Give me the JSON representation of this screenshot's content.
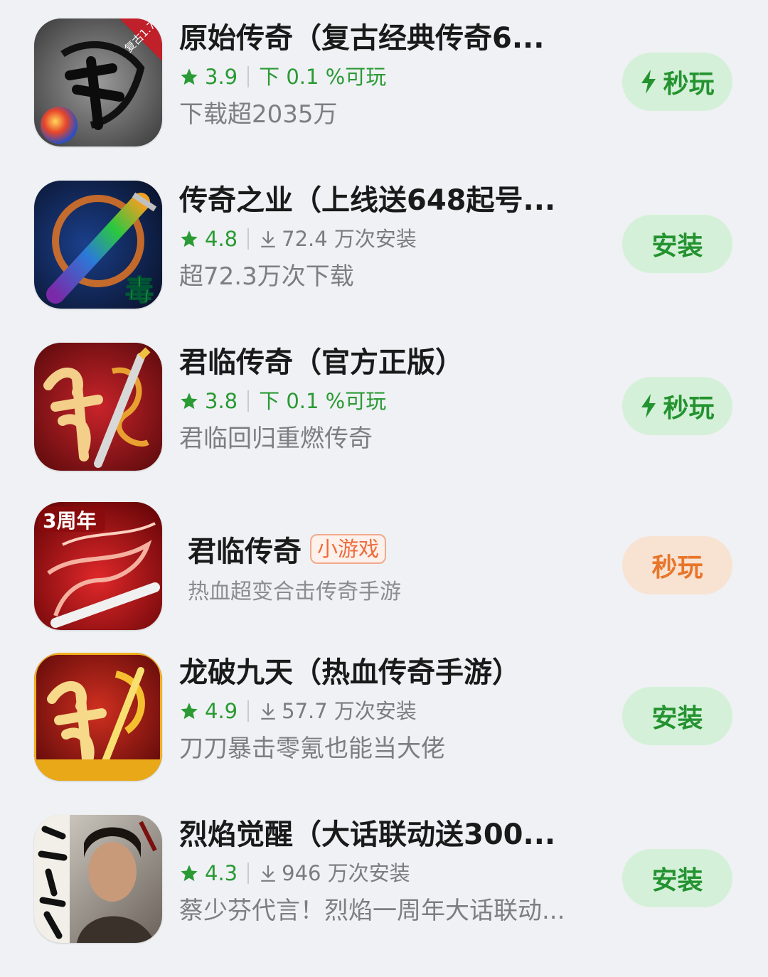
{
  "apps": [
    {
      "title": "原始传奇（复古经典传奇6...",
      "rating": "3.9",
      "meta_text": "下 0.1 %可玩",
      "desc": "下载超2035万",
      "button": "秒玩",
      "button_type": "quick"
    },
    {
      "title": "传奇之业（上线送648起号...",
      "rating": "4.8",
      "meta_text": "72.4 万次安装",
      "desc": "超72.3万次下载",
      "button": "安装",
      "button_type": "install"
    },
    {
      "title": "君临传奇（官方正版）",
      "rating": "3.8",
      "meta_text": "下 0.1 %可玩",
      "desc": "君临回归重燃传奇",
      "button": "秒玩",
      "button_type": "quick"
    },
    {
      "title": "君临传奇",
      "tag": "小游戏",
      "desc": "热血超变合击传奇手游",
      "button": "秒玩",
      "button_type": "mini"
    },
    {
      "title": "龙破九天（热血传奇手游）",
      "rating": "4.9",
      "meta_text": "57.7 万次安装",
      "desc": "刀刀暴击零氪也能当大佬",
      "button": "安装",
      "button_type": "install"
    },
    {
      "title": "烈焰觉醒（大话联动送300...",
      "rating": "4.3",
      "meta_text": "946 万次安装",
      "desc": "蔡少芬代言！烈焰一周年大话联动...",
      "button": "安装",
      "button_type": "install"
    }
  ],
  "icon_texts": {
    "app1_badge": "复古1.76",
    "app2_char": "毒",
    "app4_badge": "3周年"
  },
  "colors": {
    "background": "#eff1f4",
    "green_text": "#2a9a34",
    "green_button_bg": "#d5f0d8",
    "orange_button_bg": "#f8e2d2",
    "orange_text": "#e8762a"
  }
}
